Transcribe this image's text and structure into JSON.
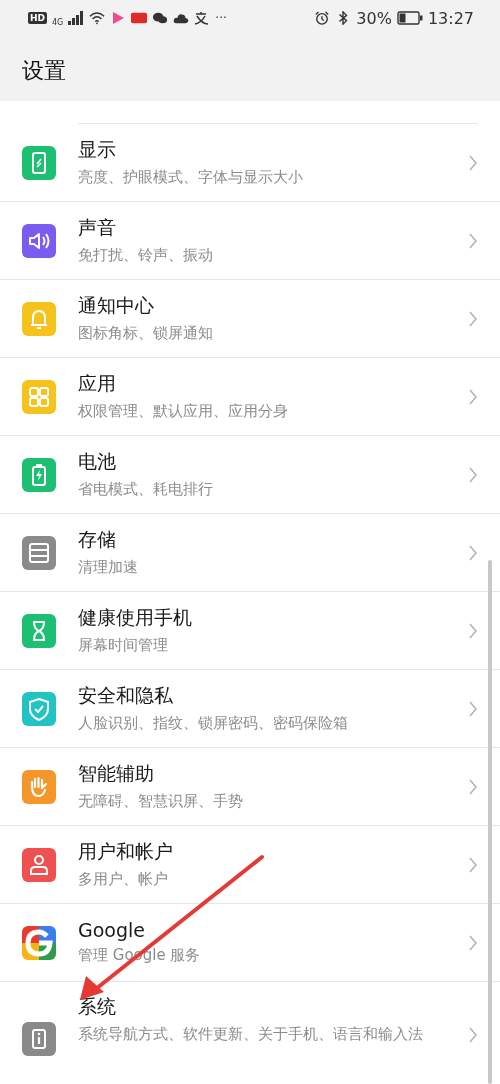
{
  "status_bar": {
    "hd": "HD",
    "network": "4G",
    "more": "···",
    "battery": "30%",
    "time": "13:27"
  },
  "header": {
    "title": "设置"
  },
  "items": [
    {
      "title": "显示",
      "subtitle": "亮度、护眼模式、字体与显示大小"
    },
    {
      "title": "声音",
      "subtitle": "免打扰、铃声、振动"
    },
    {
      "title": "通知中心",
      "subtitle": "图标角标、锁屏通知"
    },
    {
      "title": "应用",
      "subtitle": "权限管理、默认应用、应用分身"
    },
    {
      "title": "电池",
      "subtitle": "省电模式、耗电排行"
    },
    {
      "title": "存储",
      "subtitle": "清理加速"
    },
    {
      "title": "健康使用手机",
      "subtitle": "屏幕时间管理"
    },
    {
      "title": "安全和隐私",
      "subtitle": "人脸识别、指纹、锁屏密码、密码保险箱"
    },
    {
      "title": "智能辅助",
      "subtitle": "无障碍、智慧识屏、手势"
    },
    {
      "title": "用户和帐户",
      "subtitle": "多用户、帐户"
    },
    {
      "title": "Google",
      "subtitle": "管理 Google 服务"
    },
    {
      "title": "系统",
      "subtitle": "系统导航方式、软件更新、关于手机、语言和输入法"
    }
  ],
  "annotation": {
    "kind": "arrow"
  }
}
